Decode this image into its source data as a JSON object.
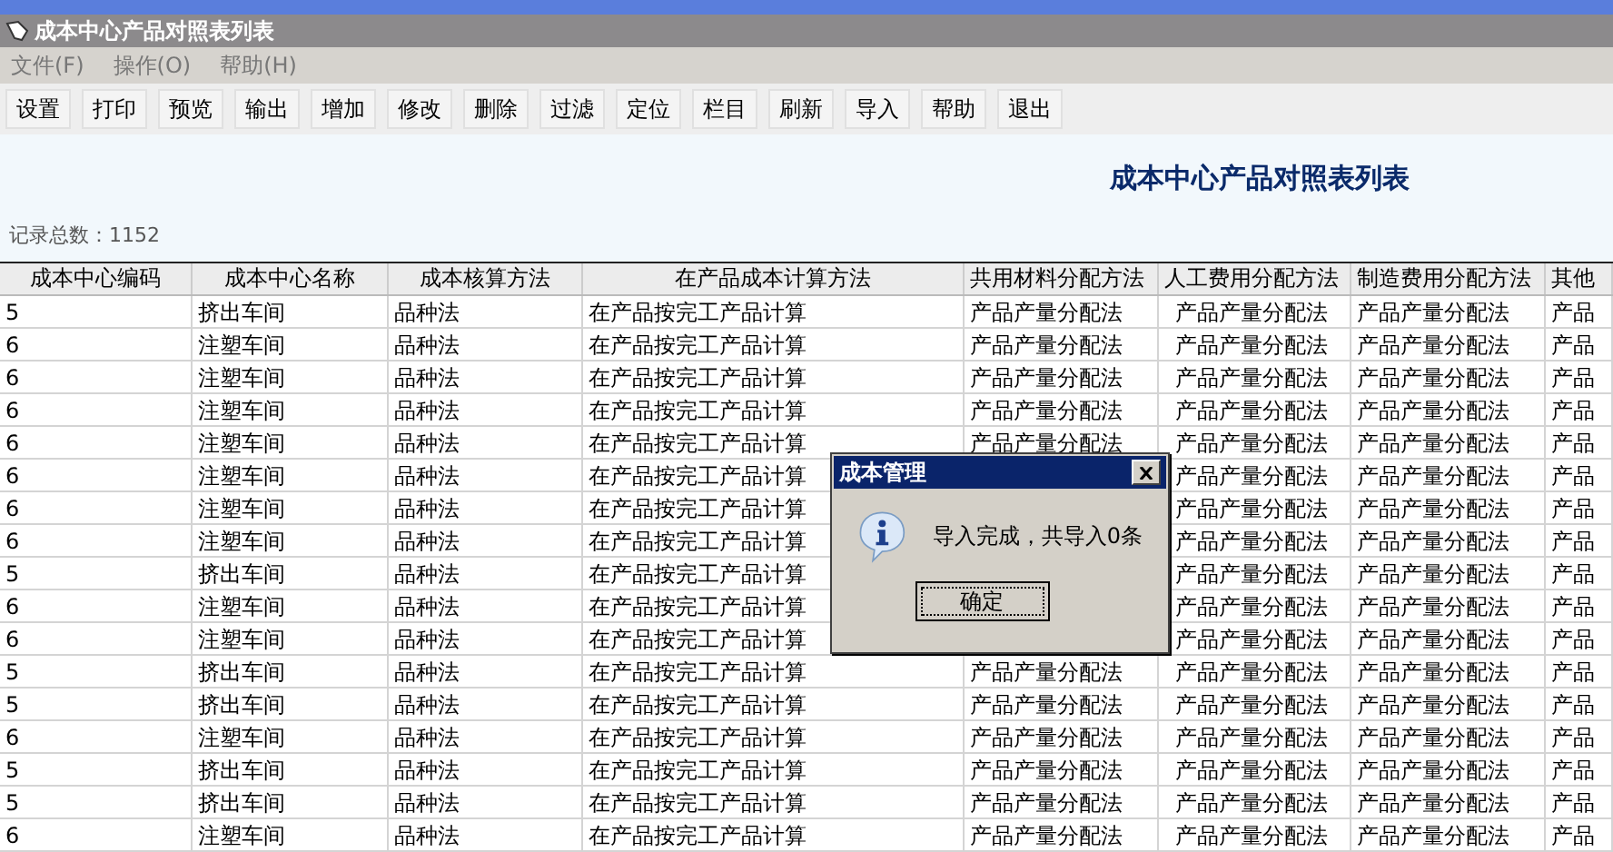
{
  "window": {
    "title": "成本中心产品对照表列表"
  },
  "menu": [
    "文件(F)",
    "操作(O)",
    "帮助(H)"
  ],
  "toolbar": [
    "设置",
    "打印",
    "预览",
    "输出",
    "增加",
    "修改",
    "删除",
    "过滤",
    "定位",
    "栏目",
    "刷新",
    "导入",
    "帮助",
    "退出"
  ],
  "heading": "成本中心产品对照表列表",
  "record_count": "记录总数：1152",
  "table": {
    "columns": [
      "成本中心编码",
      "成本中心名称",
      "成本核算方法",
      "在产品成本计算方法",
      "共用材料分配方法",
      "人工费用分配方法",
      "制造费用分配方法",
      "其他"
    ],
    "rows": [
      [
        "5",
        "挤出车间",
        "品种法",
        "在产品按完工产品计算",
        "产品产量分配法",
        "产品产量分配法",
        "产品产量分配法",
        "产品"
      ],
      [
        "6",
        "注塑车间",
        "品种法",
        "在产品按完工产品计算",
        "产品产量分配法",
        "产品产量分配法",
        "产品产量分配法",
        "产品"
      ],
      [
        "6",
        "注塑车间",
        "品种法",
        "在产品按完工产品计算",
        "产品产量分配法",
        "产品产量分配法",
        "产品产量分配法",
        "产品"
      ],
      [
        "6",
        "注塑车间",
        "品种法",
        "在产品按完工产品计算",
        "产品产量分配法",
        "产品产量分配法",
        "产品产量分配法",
        "产品"
      ],
      [
        "6",
        "注塑车间",
        "品种法",
        "在产品按完工产品计算",
        "产品产量分配法",
        "产品产量分配法",
        "产品产量分配法",
        "产品"
      ],
      [
        "6",
        "注塑车间",
        "品种法",
        "在产品按完工产品计算",
        null,
        "产品产量分配法",
        "产品产量分配法",
        "产品"
      ],
      [
        "6",
        "注塑车间",
        "品种法",
        "在产品按完工产品计算",
        null,
        "产品产量分配法",
        "产品产量分配法",
        "产品"
      ],
      [
        "6",
        "注塑车间",
        "品种法",
        "在产品按完工产品计算",
        null,
        "产品产量分配法",
        "产品产量分配法",
        "产品"
      ],
      [
        "5",
        "挤出车间",
        "品种法",
        "在产品按完工产品计算",
        null,
        "产品产量分配法",
        "产品产量分配法",
        "产品"
      ],
      [
        "6",
        "注塑车间",
        "品种法",
        "在产品按完工产品计算",
        null,
        "产品产量分配法",
        "产品产量分配法",
        "产品"
      ],
      [
        "6",
        "注塑车间",
        "品种法",
        "在产品按完工产品计算",
        null,
        "产品产量分配法",
        "产品产量分配法",
        "产品"
      ],
      [
        "5",
        "挤出车间",
        "品种法",
        "在产品按完工产品计算",
        "产品产量分配法",
        "产品产量分配法",
        "产品产量分配法",
        "产品"
      ],
      [
        "5",
        "挤出车间",
        "品种法",
        "在产品按完工产品计算",
        "产品产量分配法",
        "产品产量分配法",
        "产品产量分配法",
        "产品"
      ],
      [
        "6",
        "注塑车间",
        "品种法",
        "在产品按完工产品计算",
        "产品产量分配法",
        "产品产量分配法",
        "产品产量分配法",
        "产品"
      ],
      [
        "5",
        "挤出车间",
        "品种法",
        "在产品按完工产品计算",
        "产品产量分配法",
        "产品产量分配法",
        "产品产量分配法",
        "产品"
      ],
      [
        "5",
        "挤出车间",
        "品种法",
        "在产品按完工产品计算",
        "产品产量分配法",
        "产品产量分配法",
        "产品产量分配法",
        "产品"
      ],
      [
        "6",
        "注塑车间",
        "品种法",
        "在产品按完工产品计算",
        "产品产量分配法",
        "产品产量分配法",
        "产品产量分配法",
        "产品"
      ]
    ]
  },
  "dialog": {
    "title": "成本管理",
    "message": "导入完成，共导入0条",
    "button": "确定"
  }
}
